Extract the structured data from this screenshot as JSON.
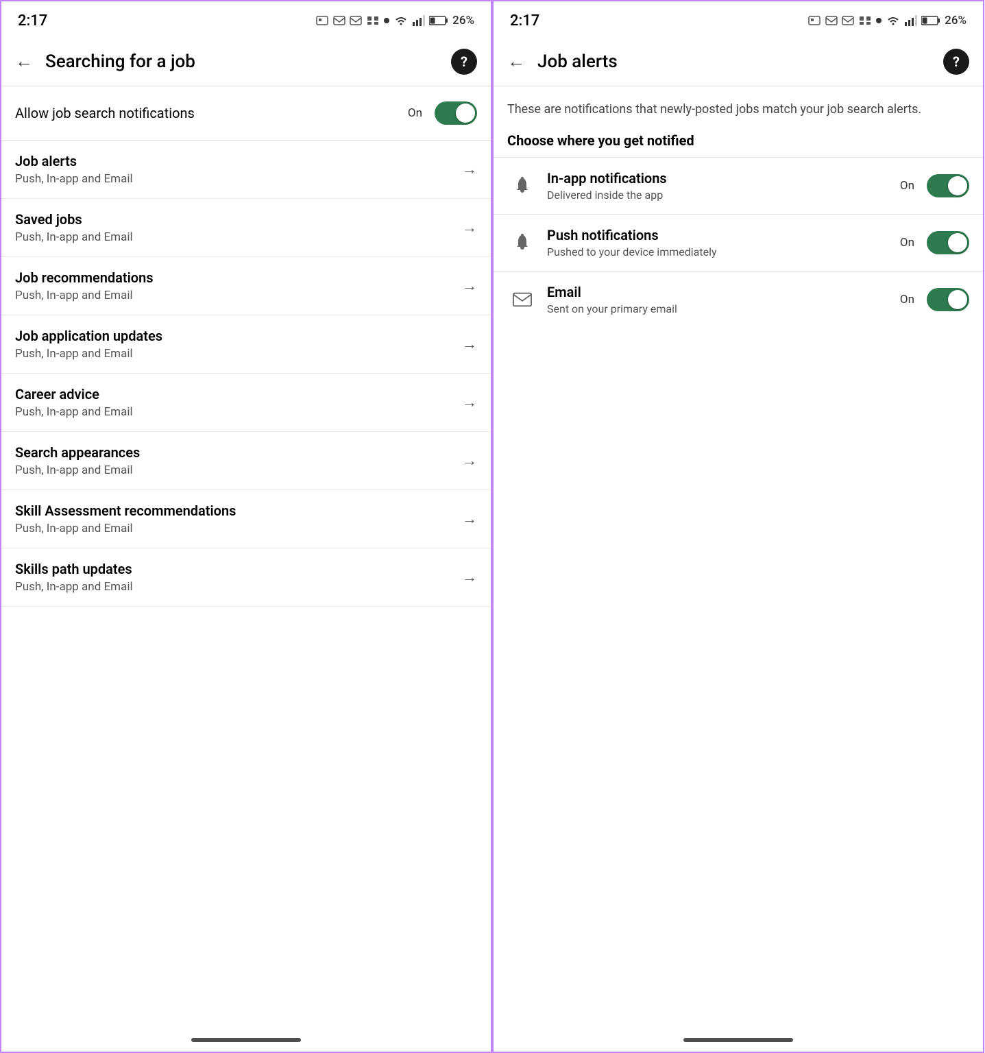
{
  "panel1": {
    "statusBar": {
      "time": "2:17",
      "battery": "26%",
      "dot": true
    },
    "header": {
      "title": "Searching for a job",
      "backArrow": "←",
      "helpIcon": "?"
    },
    "allowRow": {
      "label": "Allow job search notifications",
      "toggleLabel": "On",
      "toggleState": "on"
    },
    "menuItems": [
      {
        "title": "Job alerts",
        "subtitle": "Push, In-app and Email"
      },
      {
        "title": "Saved jobs",
        "subtitle": "Push, In-app and Email"
      },
      {
        "title": "Job recommendations",
        "subtitle": "Push, In-app and Email"
      },
      {
        "title": "Job application updates",
        "subtitle": "Push, In-app and Email"
      },
      {
        "title": "Career advice",
        "subtitle": "Push, In-app and Email"
      },
      {
        "title": "Search appearances",
        "subtitle": "Push, In-app and Email"
      },
      {
        "title": "Skill Assessment recommendations",
        "subtitle": "Push, In-app and Email"
      },
      {
        "title": "Skills path updates",
        "subtitle": "Push, In-app and Email"
      }
    ]
  },
  "panel2": {
    "statusBar": {
      "time": "2:17",
      "battery": "26%",
      "dot": true
    },
    "header": {
      "title": "Job alerts",
      "backArrow": "←",
      "helpIcon": "?"
    },
    "description": "These are notifications that newly-posted jobs match your job search alerts.",
    "sectionHeading": "Choose where you get notified",
    "notifOptions": [
      {
        "icon": "bell",
        "title": "In-app notifications",
        "subtitle": "Delivered inside the app",
        "toggleLabel": "On",
        "toggleState": "on"
      },
      {
        "icon": "bell",
        "title": "Push notifications",
        "subtitle": "Pushed to your device immediately",
        "toggleLabel": "On",
        "toggleState": "on"
      },
      {
        "icon": "email",
        "title": "Email",
        "subtitle": "Sent on your primary email",
        "toggleLabel": "On",
        "toggleState": "on"
      }
    ]
  }
}
